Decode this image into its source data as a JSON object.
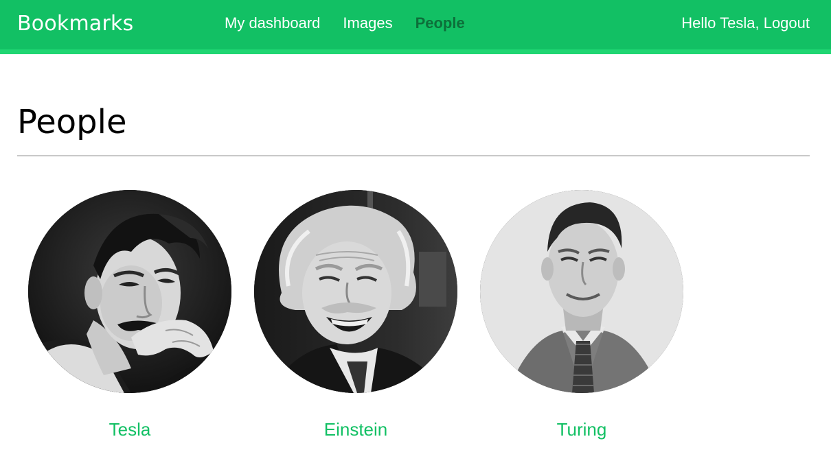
{
  "header": {
    "logo": "Bookmarks",
    "nav": [
      {
        "label": "My dashboard",
        "selected": false
      },
      {
        "label": "Images",
        "selected": false
      },
      {
        "label": "People",
        "selected": true
      }
    ],
    "greeting": "Hello Tesla,",
    "logout": "Logout"
  },
  "colors": {
    "brand": "#12c064",
    "brand_border": "#1fd672",
    "nav_selected": "#0d6f3a",
    "link": "#12c064"
  },
  "main": {
    "title": "People",
    "people": [
      {
        "name": "Tesla",
        "avatar_icon": "portrait-photo"
      },
      {
        "name": "Einstein",
        "avatar_icon": "portrait-photo"
      },
      {
        "name": "Turing",
        "avatar_icon": "portrait-photo"
      }
    ]
  }
}
